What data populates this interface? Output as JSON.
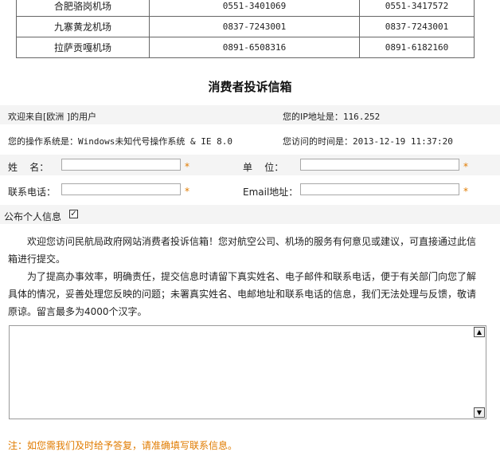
{
  "airports": [
    {
      "name": "合肥骆岗机场",
      "phone1": "0551-3401069",
      "phone2": "0551-3417572"
    },
    {
      "name": "九寨黄龙机场",
      "phone1": "0837-7243001",
      "phone2": "0837-7243001"
    },
    {
      "name": "拉萨贡嘎机场",
      "phone1": "0891-6508316",
      "phone2": "0891-6182160"
    }
  ],
  "title": "消费者投诉信箱",
  "visitor": {
    "welcome": "欢迎来自[欧洲 ]的用户",
    "ip_label": "您的IP地址是：",
    "ip_value": "116.252",
    "os_label": "您的操作系统是：",
    "os_value": "Windows未知代号操作系统 & IE 8.0",
    "time_label": "您访问的时间是：",
    "time_value": "2013-12-19 11:37:20"
  },
  "form": {
    "name_label": "姓    名：",
    "unit_label": "单    位：",
    "phone_label": "联系电话：",
    "email_label": "Email地址：",
    "name_value": "",
    "unit_value": "",
    "phone_value": "",
    "email_value": "",
    "required_mark": "*",
    "public_label": "公布个人信息",
    "public_checked": true,
    "check_glyph": "✓"
  },
  "intro": {
    "p1": "欢迎您访问民航局政府网站消费者投诉信箱！您对航空公司、机场的服务有何意见或建议，可直接通过此信箱进行提交。",
    "p2": "为了提高办事效率，明确责任，提交信息时请留下真实姓名、电子邮件和联系电话，便于有关部门向您了解具体的情况，妥善处理您反映的问题；未署真实姓名、电邮地址和联系电话的信息，我们无法处理与反馈，敬请原谅。留言最多为4000个汉字。"
  },
  "message_value": "",
  "scroll_up_glyph": "▲",
  "scroll_down_glyph": "▼",
  "note": "注：如您需我们及时给予答复，请准确填写联系信息。",
  "colors": {
    "accent": "#e07b00",
    "band": "#f4f4f4"
  }
}
